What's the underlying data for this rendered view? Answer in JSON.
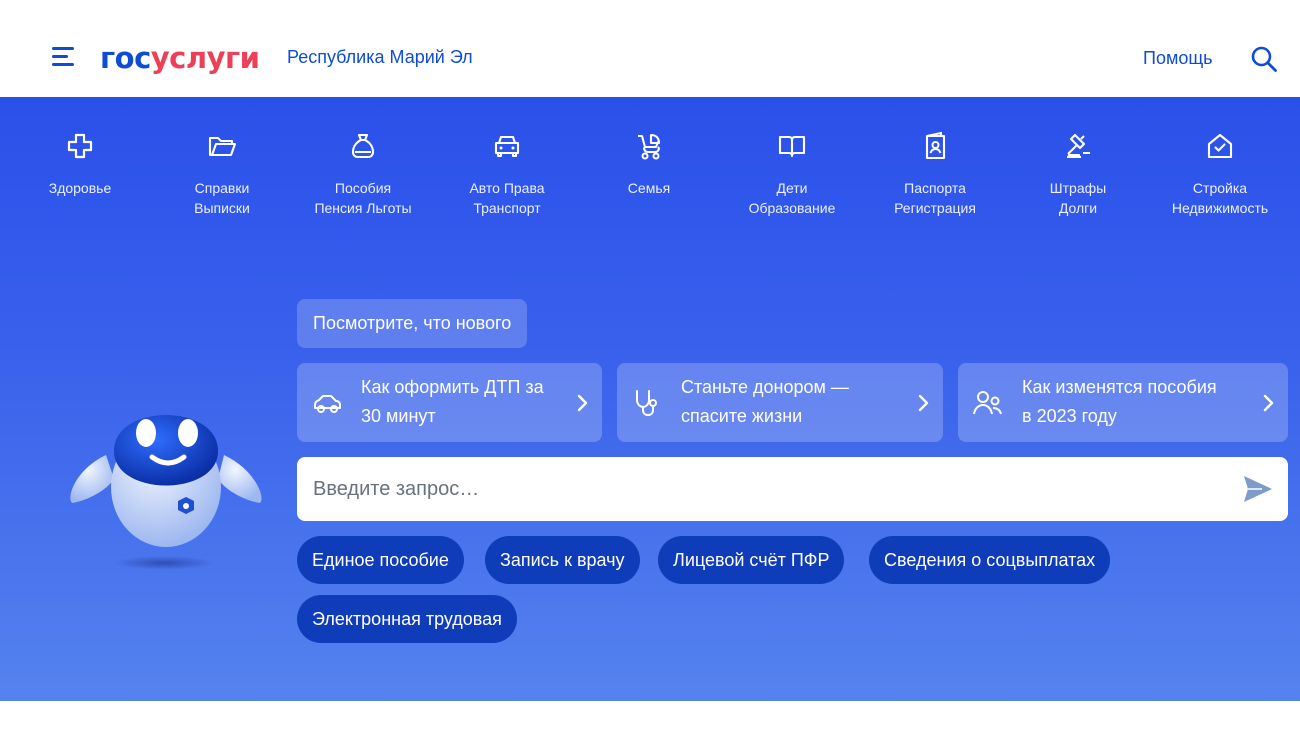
{
  "header": {
    "logo_part1": "гос",
    "logo_part2": "услуги",
    "region": "Республика Марий Эл",
    "help": "Помощь"
  },
  "categories": [
    {
      "icon": "health-cross-icon",
      "line1": "Здоровье",
      "line2": ""
    },
    {
      "icon": "folder-icon",
      "line1": "Справки",
      "line2": "Выписки"
    },
    {
      "icon": "money-bag-icon",
      "line1": "Пособия",
      "line2": "Пенсия Льготы"
    },
    {
      "icon": "car-icon",
      "line1": "Авто Права",
      "line2": "Транспорт"
    },
    {
      "icon": "stroller-icon",
      "line1": "Семья",
      "line2": ""
    },
    {
      "icon": "open-book-icon",
      "line1": "Дети",
      "line2": "Образование"
    },
    {
      "icon": "passport-icon",
      "line1": "Паспорта",
      "line2": "Регистрация"
    },
    {
      "icon": "gavel-icon",
      "line1": "Штрафы",
      "line2": "Долги"
    },
    {
      "icon": "house-icon",
      "line1": "Стройка",
      "line2": "Недвижимость"
    }
  ],
  "whatsnew": "Посмотрите, что нового",
  "news": [
    {
      "icon": "car-icon",
      "line1": "Как оформить ДТП за",
      "line2": "30 минут"
    },
    {
      "icon": "stethoscope-icon",
      "line1": "Станьте донором —",
      "line2": "спасите жизни"
    },
    {
      "icon": "people-icon",
      "line1": "Как изменятся пособия",
      "line2": "в 2023 году"
    }
  ],
  "search": {
    "placeholder": "Введите запрос…",
    "value": ""
  },
  "chips": [
    "Единое пособие",
    "Запись к врачу",
    "Лицевой счёт ПФР",
    "Сведения о соцвыплатах",
    "Электронная трудовая"
  ],
  "colors": {
    "brand_blue": "#0d4cd3",
    "brand_red": "#ee3f58",
    "hero_top": "#2a50ea",
    "hero_bottom": "#5583ee",
    "chip_bg": "#0f3cb8"
  }
}
